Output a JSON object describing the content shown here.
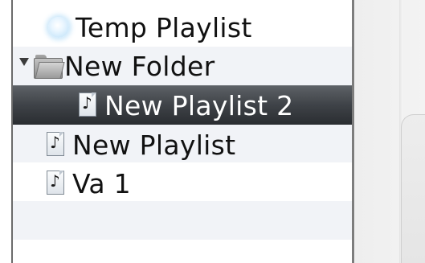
{
  "sidebar": {
    "items": [
      {
        "label": "Temp Playlist",
        "icon": "smart-playlist-icon"
      },
      {
        "label": "New Folder",
        "icon": "folder-icon",
        "expanded": true
      },
      {
        "label": "New Playlist 2",
        "icon": "playlist-icon",
        "selected": true
      },
      {
        "label": "New Playlist",
        "icon": "playlist-icon"
      },
      {
        "label": "Va 1",
        "icon": "playlist-icon"
      }
    ],
    "note_glyph": "♪"
  },
  "colors": {
    "selection_dark": "#2a2d31",
    "selection_light": "#5d6166",
    "stripe_alt": "#f1f3f7"
  }
}
